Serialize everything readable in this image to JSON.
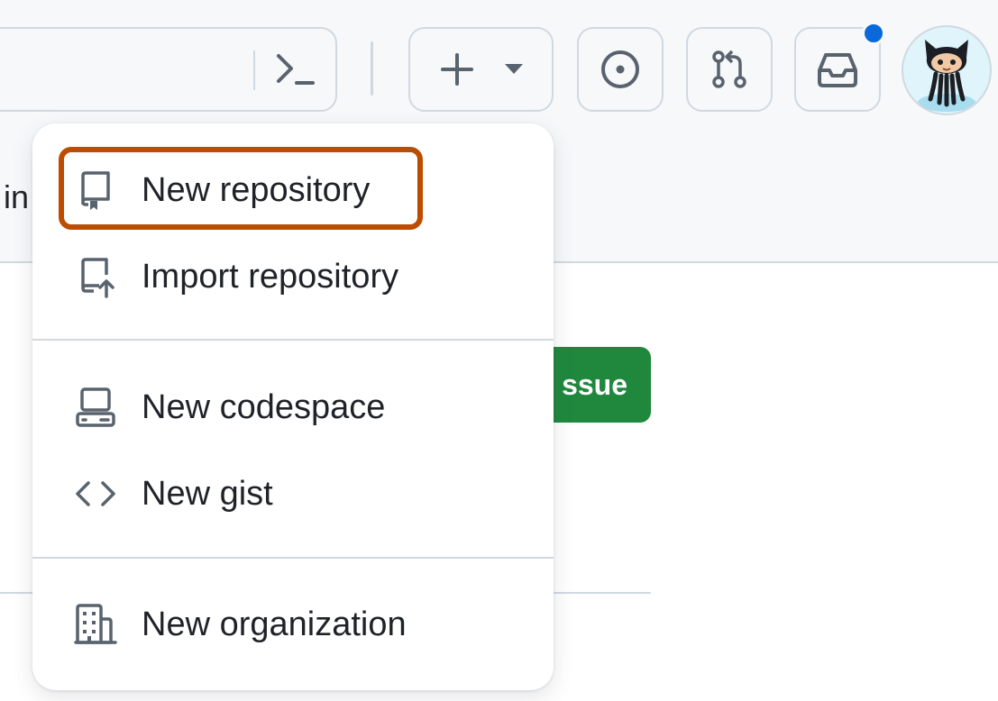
{
  "header": {
    "command_palette_glyph": ">_",
    "create_button_icon": "plus-icon",
    "create_dropdown_icon": "triangle-down-icon",
    "issues_icon": "issue-opened-icon",
    "pulls_icon": "git-pull-request-icon",
    "inbox_icon": "inbox-icon",
    "notification_color": "#0969da",
    "avatar_icon": "octocat-avatar"
  },
  "background": {
    "cut_text": "in",
    "action_button_label": "ssue",
    "action_button_color": "#1f883d"
  },
  "menu": {
    "highlight_color": "#bc4c00",
    "items": [
      {
        "label": "New repository",
        "icon": "repo-icon"
      },
      {
        "label": "Import repository",
        "icon": "repo-push-icon"
      },
      {
        "label": "New codespace",
        "icon": "codespaces-icon"
      },
      {
        "label": "New gist",
        "icon": "code-icon"
      },
      {
        "label": "New organization",
        "icon": "organization-icon"
      }
    ]
  }
}
